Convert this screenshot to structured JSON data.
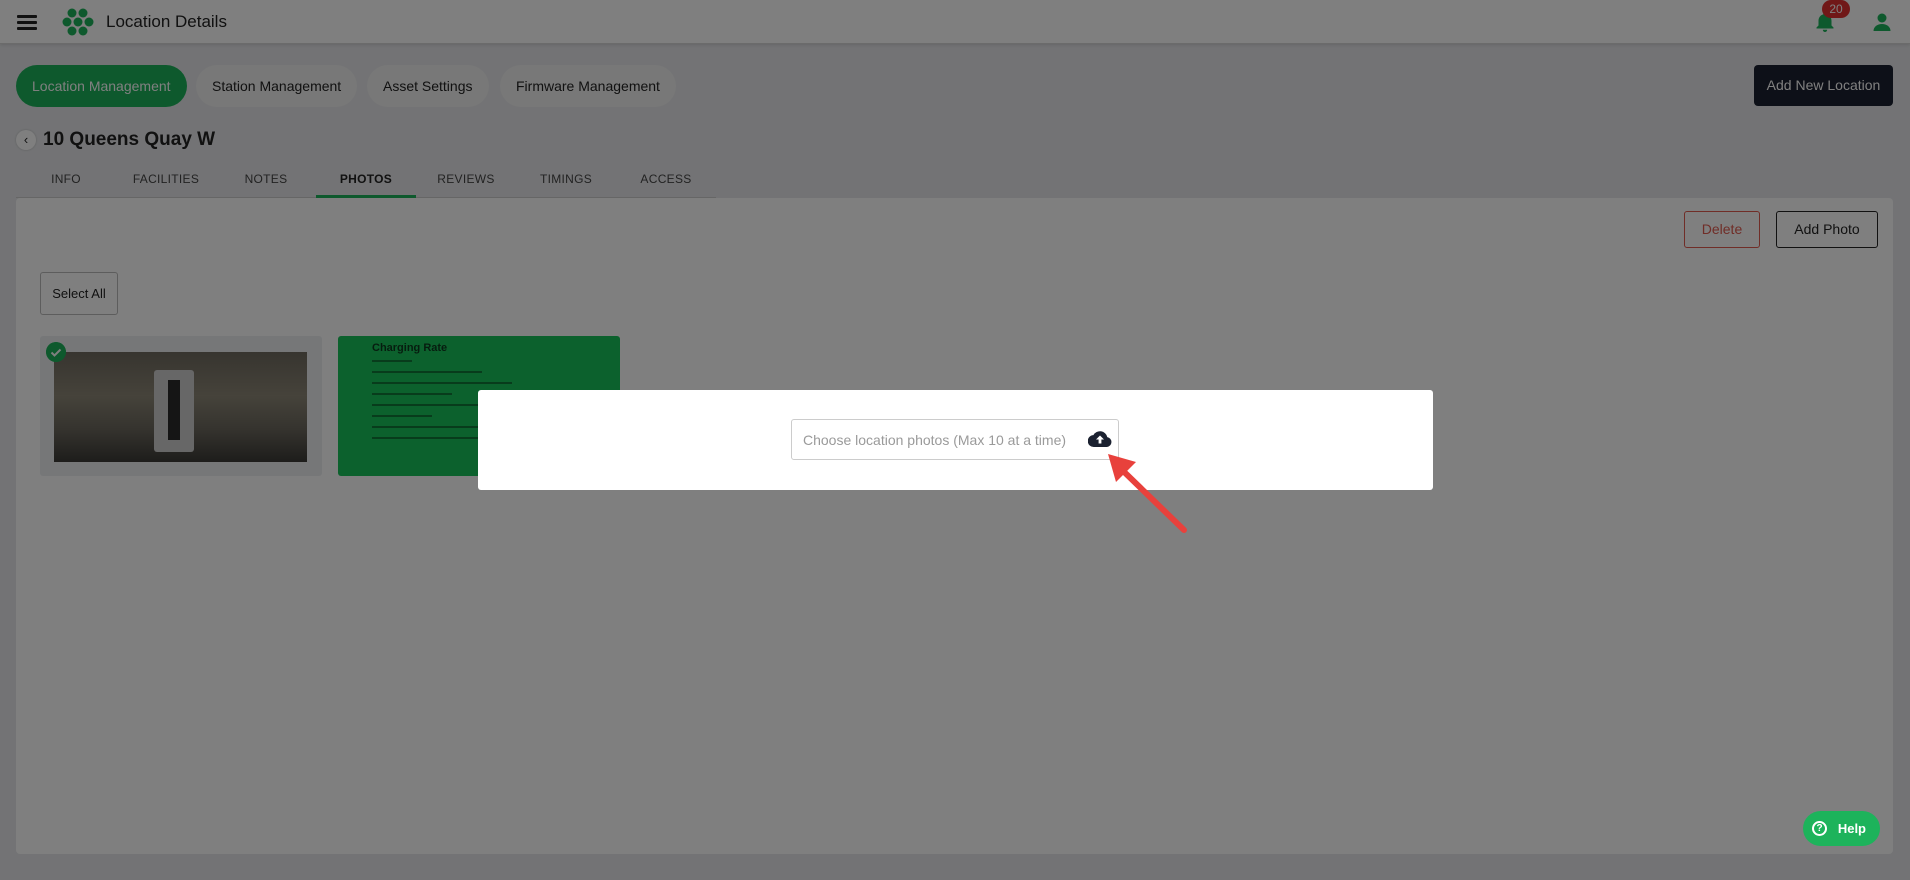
{
  "header": {
    "title": "Location Details",
    "notification_count": "20",
    "accent_color": "#1db35b",
    "icons": [
      "menu-icon",
      "logo-icon",
      "bell-icon",
      "user-icon"
    ]
  },
  "nav": {
    "pills": [
      {
        "label": "Location Management",
        "active": true
      },
      {
        "label": "Station Management",
        "active": false
      },
      {
        "label": "Asset Settings",
        "active": false
      },
      {
        "label": "Firmware Management",
        "active": false
      }
    ],
    "add_location_label": "Add New Location"
  },
  "location": {
    "name": "10 Queens Quay W"
  },
  "tabs": [
    {
      "label": "INFO"
    },
    {
      "label": "FACILITIES"
    },
    {
      "label": "NOTES"
    },
    {
      "label": "PHOTOS",
      "active": true
    },
    {
      "label": "REVIEWS"
    },
    {
      "label": "TIMINGS"
    },
    {
      "label": "ACCESS"
    }
  ],
  "photos_panel": {
    "delete_label": "Delete",
    "add_photo_label": "Add Photo",
    "select_all_label": "Select All",
    "photos": [
      {
        "selected": true
      },
      {
        "caption": "Charging Rate",
        "selected": false
      }
    ]
  },
  "modal": {
    "file_placeholder": "Choose location photos (Max 10 at a time)",
    "upload_icon": "cloud-upload-icon"
  },
  "help": {
    "label": "Help"
  }
}
